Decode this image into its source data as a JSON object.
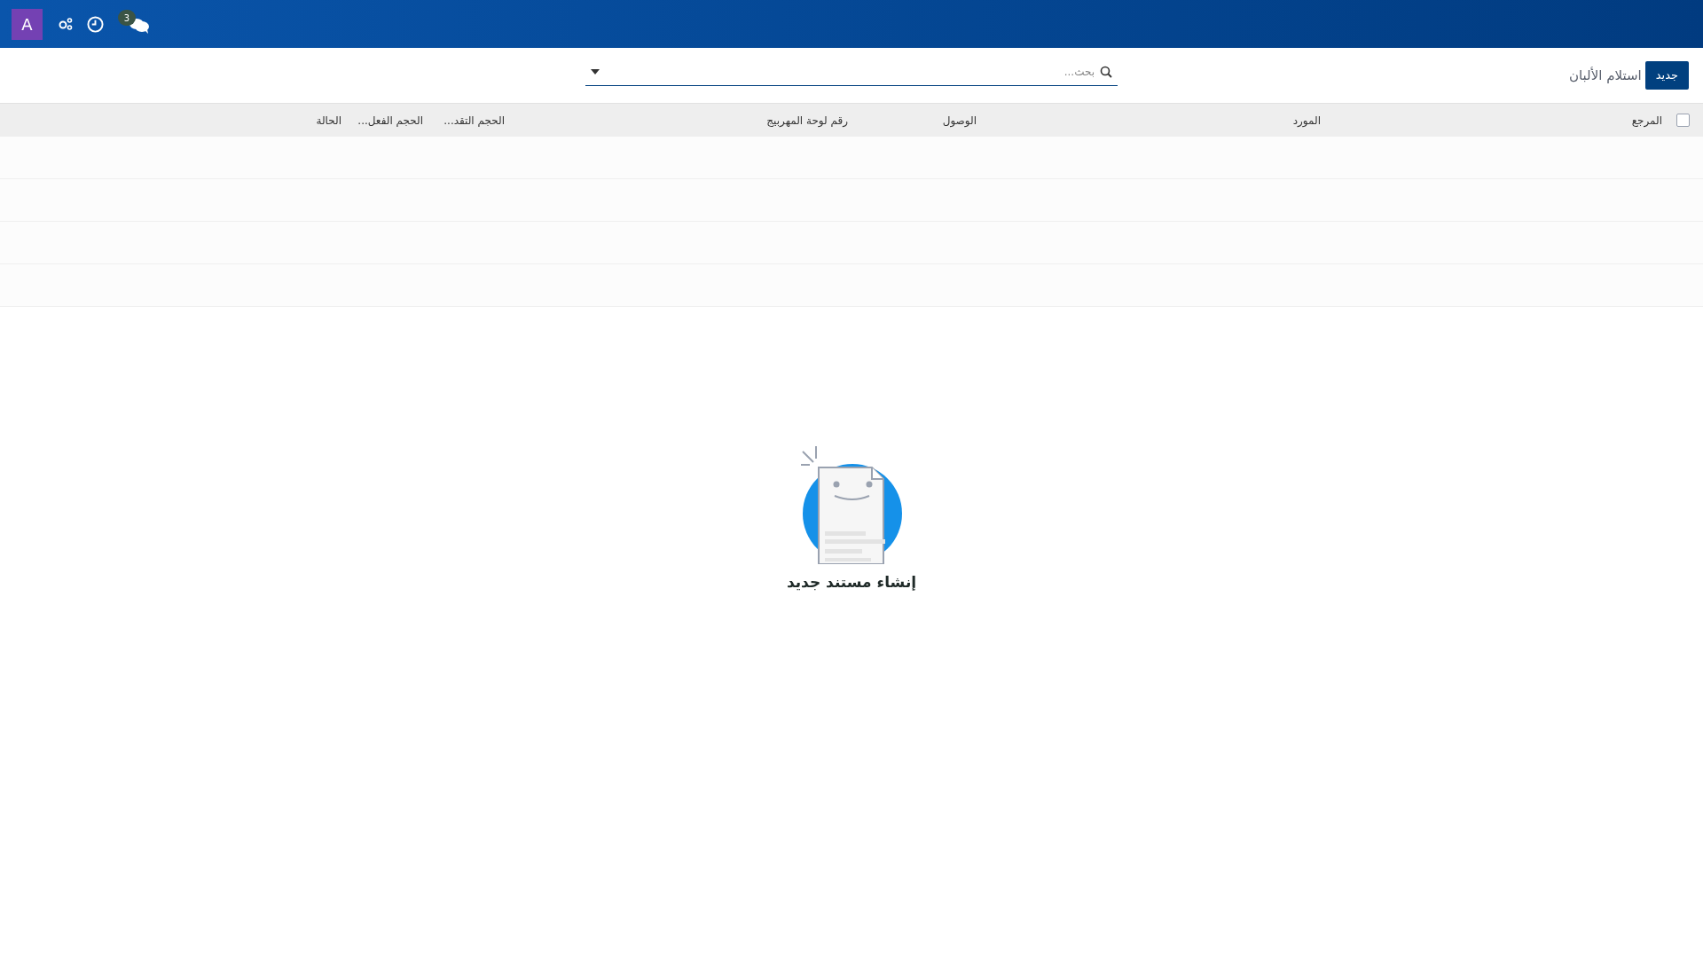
{
  "navbar": {
    "avatar": "A",
    "chat_badge": "3"
  },
  "control_panel": {
    "new_button": "جديد",
    "breadcrumb": "استلام الألبان",
    "search": {
      "placeholder": "بحث..."
    }
  },
  "table": {
    "select_all": {
      "checked": false
    },
    "columns": [
      "المرجع",
      "المورد",
      "الوصول",
      "رقم لوحة المهربيج",
      "الحجم التقد...",
      "الحجم الفعل...",
      "الحالة"
    ]
  },
  "empty_state": {
    "title": "إنشاء مستند جديد"
  }
}
